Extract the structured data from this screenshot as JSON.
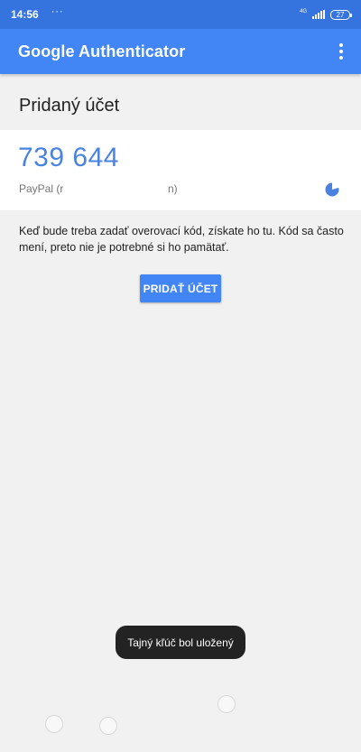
{
  "status_bar": {
    "time": "14:56",
    "dots": "···",
    "network_label": "4G",
    "battery": "27"
  },
  "app_bar": {
    "title": "Google Authenticator",
    "menu_icon": "more-vert-icon"
  },
  "section": {
    "title": "Pridaný účet"
  },
  "account": {
    "code": "739 644",
    "name_start": "PayPal (r",
    "name_end": "n)",
    "timer_icon": "countdown-pie-icon"
  },
  "info": {
    "text": "Keď bude treba zadať overovací kód, získate ho tu. Kód sa často mení, preto nie je potrebné si ho pamätať."
  },
  "add_button": {
    "label": "PRIDAŤ ÚČET"
  },
  "toast": {
    "message": "Tajný kľúč bol uložený"
  },
  "colors": {
    "status_bar": "#3574de",
    "app_bar": "#4285f4",
    "code": "#4a83df",
    "background": "#f1f1f1"
  }
}
